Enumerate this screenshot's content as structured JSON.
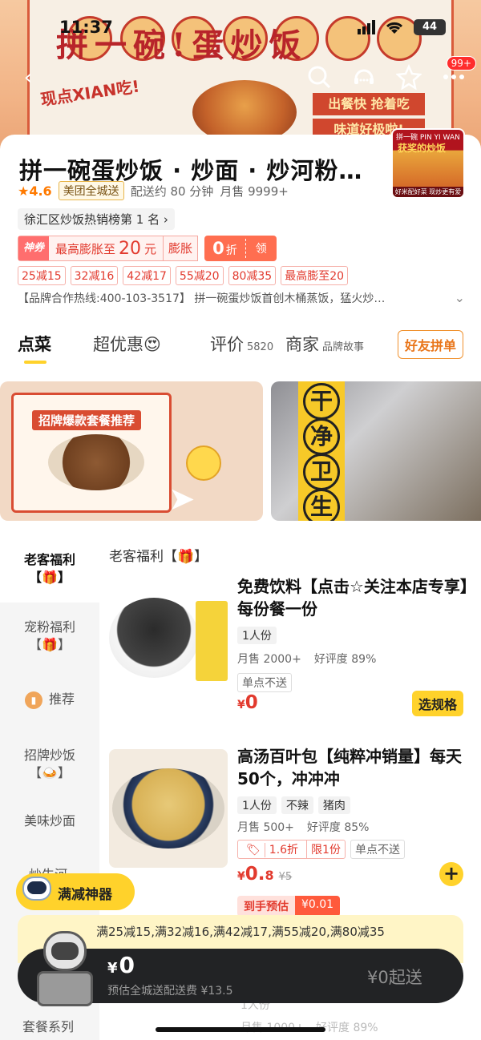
{
  "status_bar": {
    "time": "11:37",
    "battery": "44"
  },
  "banner": {
    "title": "拼一碗!蛋炒饭",
    "slogan": "现点XIAN吃!",
    "tag_lines": [
      "出餐快 抢着吃",
      "味道好极啦!"
    ],
    "notification_count": "99+"
  },
  "store": {
    "name": "拼一碗蛋炒饭 · 炒面 · 炒河粉…",
    "thumb": {
      "top": "拼一碗 PIN YI WAN",
      "mid": "获奖的炒饭",
      "bottom": "好米配好菜 现炒更有爱"
    },
    "rating": "★4.6",
    "delivery_tag": "美团全城送",
    "delivery_time": "配送约 80 分钟",
    "monthly_sales": "月售 9999+",
    "rank": "徐汇区炒饭热销榜第 1 名 ›",
    "coupon": {
      "badge": "神券",
      "text_prefix": "最高膨胀至",
      "amount": "20",
      "unit": "元",
      "action": "膨胀",
      "zero_amount": "0",
      "zero_unit": "折",
      "zero_action": "领"
    },
    "discounts": [
      "25减15",
      "32减16",
      "42减17",
      "55减20",
      "80减35",
      "最高膨至20"
    ],
    "notice": "【品牌合作热线:400-103-3517】 拼一碗蛋炒饭首创木桶蒸饭，猛火炒…",
    "notice_arrow": "⌄"
  },
  "tabs": {
    "order": "点菜",
    "deals": "超优惠😍",
    "reviews": "评价",
    "review_count": "5820",
    "merchant": "商家",
    "merchant_sub": "品牌故事",
    "friend_order": "好友拼单"
  },
  "promos": {
    "left_label": "招牌爆款套餐推荐",
    "right_chars": [
      "干",
      "净",
      "卫",
      "生"
    ]
  },
  "sidebar": {
    "items": [
      "老客福利\n【🎁】",
      "宠粉福利\n【🎁】",
      "推荐",
      "招牌炒饭\n【🍛】",
      "美味炒面",
      "炒牛河",
      "套餐系列"
    ]
  },
  "menu": {
    "section_title": "老客福利【🎁】",
    "items": [
      {
        "name": "免费饮料【点击☆关注本店专享】每份餐一份",
        "chips": [
          "1人份"
        ],
        "monthly_sales": "月售 2000+",
        "rating": "好评度 89%",
        "restriction": "单点不送",
        "price": "0",
        "action": "选规格"
      },
      {
        "name": "高汤百叶包【纯粹冲销量】每天50个，冲冲冲",
        "chips": [
          "1人份",
          "不辣",
          "猪肉"
        ],
        "monthly_sales": "月售 500+",
        "rating": "好评度 85%",
        "discount": "1.6折",
        "limit": "限1份",
        "restriction": "单点不送",
        "price": "0.",
        "price_decimal": "8",
        "price_original": "¥5",
        "arrival_label": "到手预估",
        "arrival_price": "¥0.01",
        "action": "+"
      }
    ]
  },
  "bottom": {
    "manjian_label": "满减神器",
    "promo_strip": "满25减15,满32减16,满42减17,满55减20,满80减35",
    "cart_price": "0",
    "delivery_fee": "预估全城送配送费 ¥13.5",
    "min_order": "¥0起送",
    "hidden_text_1": "1人份",
    "hidden_text_2": "月售 1000+",
    "hidden_text_3": "好评度 89%"
  },
  "colors": {
    "accent": "#ffd22b",
    "price": "#e23a2e",
    "cart_bar": "#222325"
  }
}
